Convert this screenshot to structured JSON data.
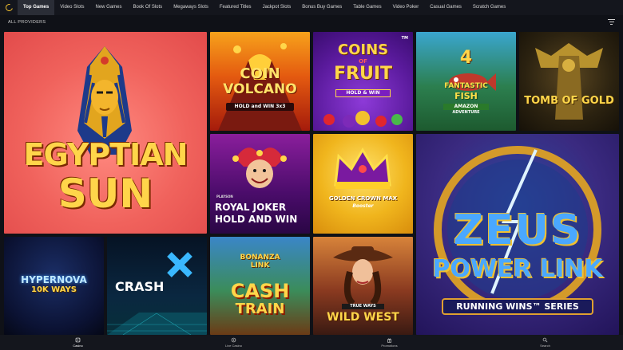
{
  "nav": {
    "tabs": [
      {
        "label": "Top Games",
        "active": true
      },
      {
        "label": "Video Slots"
      },
      {
        "label": "New Games"
      },
      {
        "label": "Book Of Slots"
      },
      {
        "label": "Megaways Slots"
      },
      {
        "label": "Featured Titles"
      },
      {
        "label": "Jackpot Slots"
      },
      {
        "label": "Bonus Buy Games"
      },
      {
        "label": "Table Games"
      },
      {
        "label": "Video Poker"
      },
      {
        "label": "Casual Games"
      },
      {
        "label": "Scratch Games"
      }
    ]
  },
  "filter": {
    "label": "ALL PROVIDERS",
    "icon": "filter-icon"
  },
  "games": {
    "egyptian_sun": {
      "line1": "EGYPTIAN",
      "line2": "SUN"
    },
    "coin_volcano": {
      "line1": "COIN",
      "line2": "VOLCANO",
      "badge": "HOLD and WIN 3x3"
    },
    "coins_of_fruit": {
      "line1": "COINS",
      "of": "OF",
      "line2": "FRUIT",
      "badge": "HOLD & WIN",
      "tm": "TM"
    },
    "fantastic_fish": {
      "number": "4",
      "line1": "FANTASTIC",
      "line2": "FISH",
      "line3": "AMAZON",
      "line4": "ADVENTURE"
    },
    "tomb_of_gold": {
      "title": "TOMB OF GOLD"
    },
    "royal_joker": {
      "provider": "PLAYSON",
      "line1": "ROYAL JOKER",
      "line2": "HOLD AND WIN"
    },
    "golden_crown": {
      "line1": "GOLDEN CROWN MAX",
      "line2": "Booster"
    },
    "zeus": {
      "line1": "ZEUS",
      "line2": "POWER LINK",
      "badge": "RUNNING WINS™ SERIES"
    },
    "hypernova": {
      "line1": "HYPERNOVA",
      "line2": "10K WAYS"
    },
    "crash_x": {
      "title": "CRASH"
    },
    "bonanza": {
      "line1": "BONANZA",
      "line2": "LINK",
      "line3": "CASH",
      "line4": "TRAIN"
    },
    "wild_west": {
      "badge": "TRUE WAYS",
      "title": "WILD WEST"
    }
  },
  "bottom_nav": [
    {
      "label": "Casino",
      "icon": "casino-icon",
      "active": true
    },
    {
      "label": "Live Casino",
      "icon": "live-casino-icon"
    },
    {
      "label": "Promotions",
      "icon": "promotions-icon"
    },
    {
      "label": "Search",
      "icon": "search-icon"
    }
  ],
  "colors": {
    "accent": "#f2c12e",
    "background": "#0f1117",
    "nav": "#14161d",
    "active_tab": "#2a2d36"
  }
}
